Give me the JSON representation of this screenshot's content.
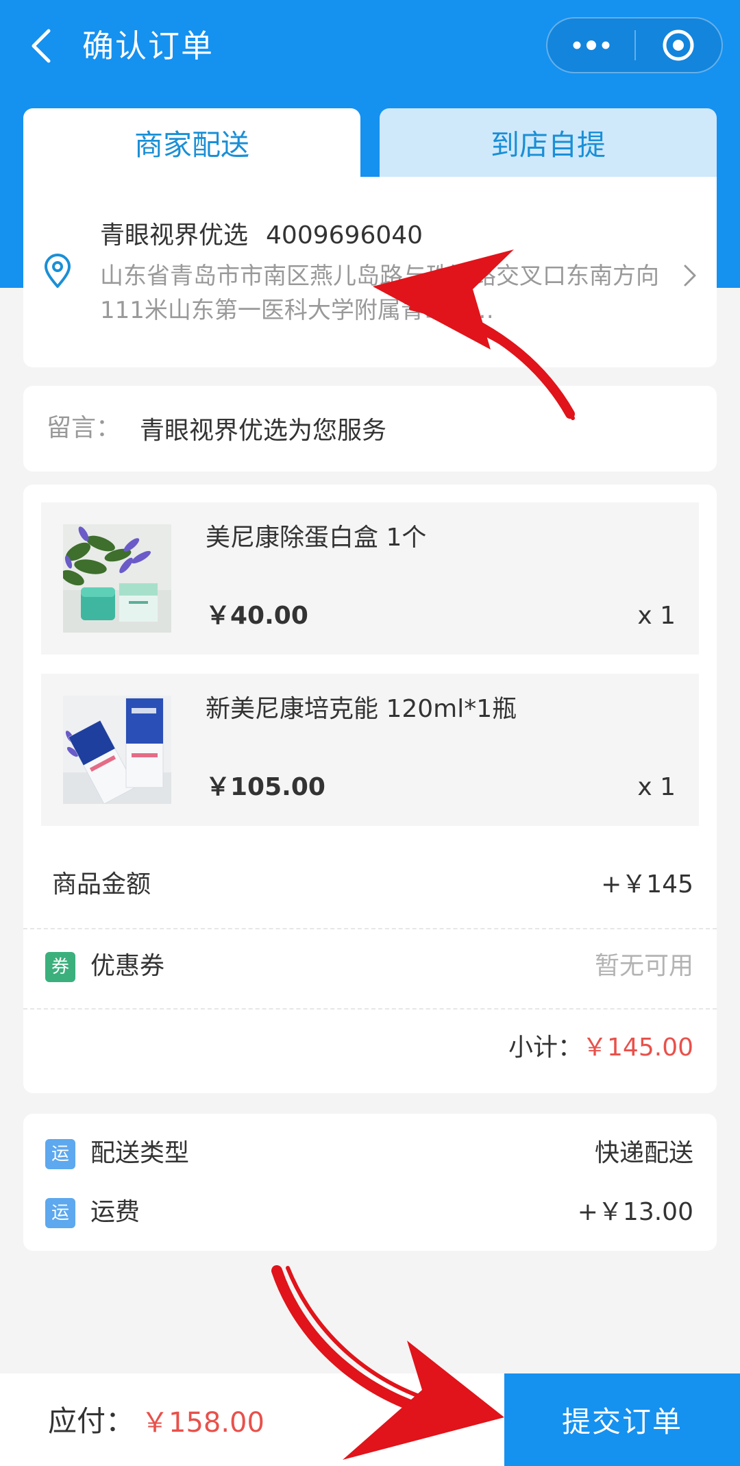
{
  "header": {
    "title": "确认订单",
    "back_icon": "back-arrow-icon",
    "more_icon": "more-dots-icon",
    "close_icon": "target-close-icon"
  },
  "tabs": [
    {
      "label": "商家配送",
      "active": true
    },
    {
      "label": "到店自提",
      "active": false
    }
  ],
  "address": {
    "name": "青眼视界优选",
    "phone": "4009696040",
    "full_address": "山东省青岛市市南区燕儿岛路与珠海路交叉口东南方向111米山东第一医科大学附属青岛眼…",
    "icon": "location-pin-icon"
  },
  "message": {
    "label": "留言：",
    "value": "青眼视界优选为您服务"
  },
  "products": [
    {
      "name": "美尼康除蛋白盒 1个",
      "price": "￥40.00",
      "quantity": "x 1"
    },
    {
      "name": "新美尼康培克能 120ml*1瓶",
      "price": "￥105.00",
      "quantity": "x 1"
    }
  ],
  "summary": {
    "goods_amount_label": "商品金额",
    "goods_amount_value": "+￥145",
    "coupon_badge": "券",
    "coupon_label": "优惠券",
    "coupon_value": "暂无可用",
    "subtotal_label": "小计：",
    "subtotal_value": "￥145.00"
  },
  "delivery": {
    "type_badge": "运",
    "type_label": "配送类型",
    "type_value": "快递配送",
    "fee_badge": "运",
    "fee_label": "运费",
    "fee_value": "+￥13.00"
  },
  "footer": {
    "payable_label": "应付：",
    "payable_value": "￥158.00",
    "submit_label": "提交订单"
  },
  "colors": {
    "primary": "#1591f0",
    "price_red": "#e8514b",
    "coupon_green": "#3bb07d",
    "shipping_blue": "#5da8ee",
    "annotation_red": "#e0141a"
  }
}
